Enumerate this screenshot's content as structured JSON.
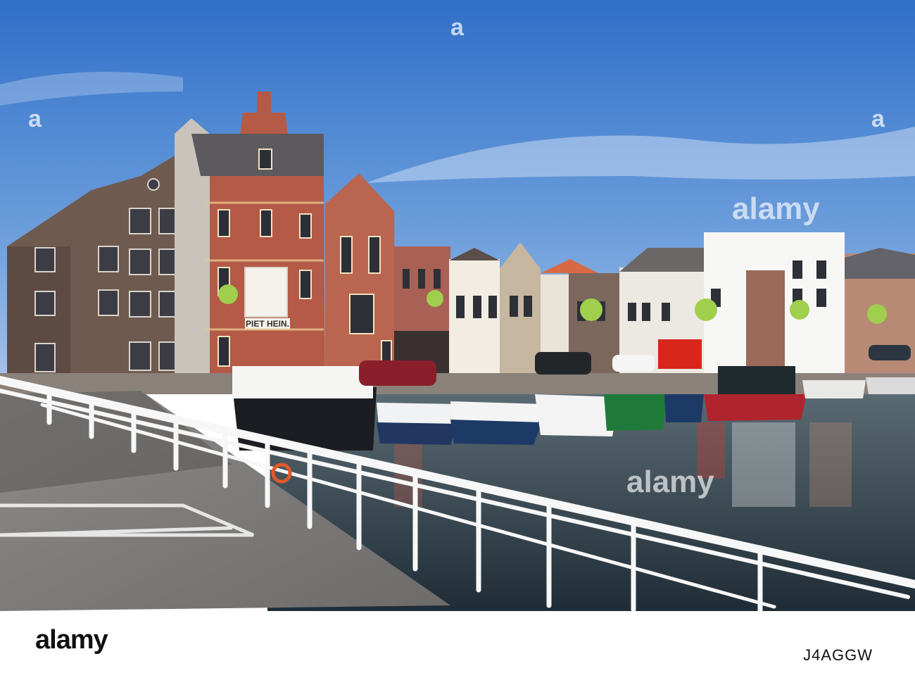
{
  "photo": {
    "building_sign": "PIET HEIN.",
    "watermark_text": "alamy",
    "watermark_glyph": "a"
  },
  "footer": {
    "brand": "alamy",
    "image_id": "J4AGGW"
  }
}
